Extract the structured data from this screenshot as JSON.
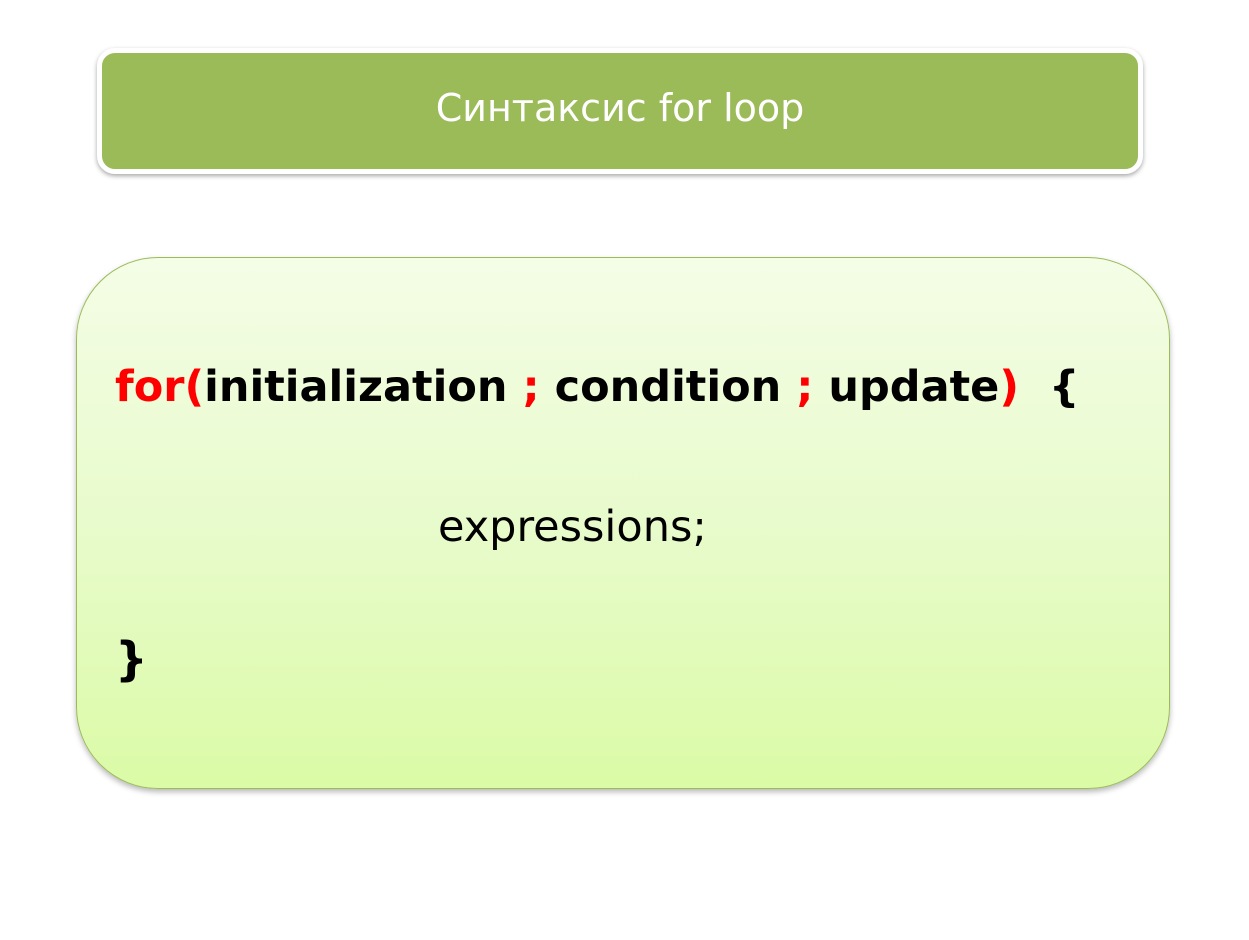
{
  "slide": {
    "title": "Синтаксис for loop"
  },
  "code": {
    "keyword": "for",
    "open_paren": "(",
    "initialization": "initialization",
    "separator_1": " ; ",
    "condition": "condition",
    "separator_2": " ; ",
    "update": "update",
    "close_paren": ")",
    "open_brace": "  {",
    "body": "expressions;",
    "close_brace": "}"
  },
  "colors": {
    "title_background": "#9bbb59",
    "title_text": "#ffffff",
    "panel_top": "#f4fde6",
    "panel_bottom": "#dbfba6",
    "keyword": "#ff0000",
    "text": "#000000"
  }
}
